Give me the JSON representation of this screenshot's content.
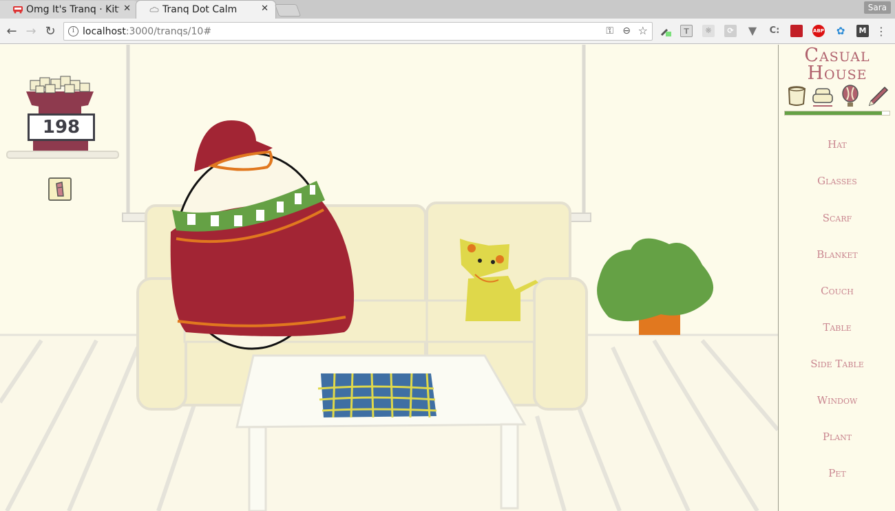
{
  "browser": {
    "tabs": [
      {
        "title": "Omg It's Tranq · Kitt",
        "active": false
      },
      {
        "title": "Tranq Dot Calm ︎︎︎",
        "active": true
      }
    ],
    "profile_name": "Sara",
    "url_host": "localhost",
    "url_path": ":3000/tranqs/10#",
    "extensions": [
      "eyedropper-icon",
      "text-icon",
      "gear-ext-icon",
      "sync-icon",
      "v-icon",
      "c-icon",
      "book-icon",
      "abp-icon",
      "blue-ext-icon",
      "m-icon"
    ],
    "ext_labels": {
      "abp": "ABP",
      "m": "M",
      "c": "C:",
      "t": "T"
    }
  },
  "game": {
    "counter": "198",
    "progress_fraction": 0.93
  },
  "sidebar": {
    "title_line1": "Casual",
    "title_line2": "House",
    "categories": [
      "marshmallow-icon",
      "armchair-icon",
      "balloon-icon",
      "pencil-icon"
    ],
    "items": [
      "Hat",
      "Glasses",
      "Scarf",
      "Blanket",
      "Couch",
      "Table",
      "Side Table",
      "Window",
      "Plant",
      "Pet"
    ]
  },
  "colors": {
    "accent": "#b0616d",
    "item_text": "#c9858f",
    "progress": "#65a145",
    "sweater": "#a22534",
    "scarf": "#65a145",
    "pet": "#dfd84a",
    "blanket": "#3f6fa3",
    "couch": "#f5efc9"
  }
}
